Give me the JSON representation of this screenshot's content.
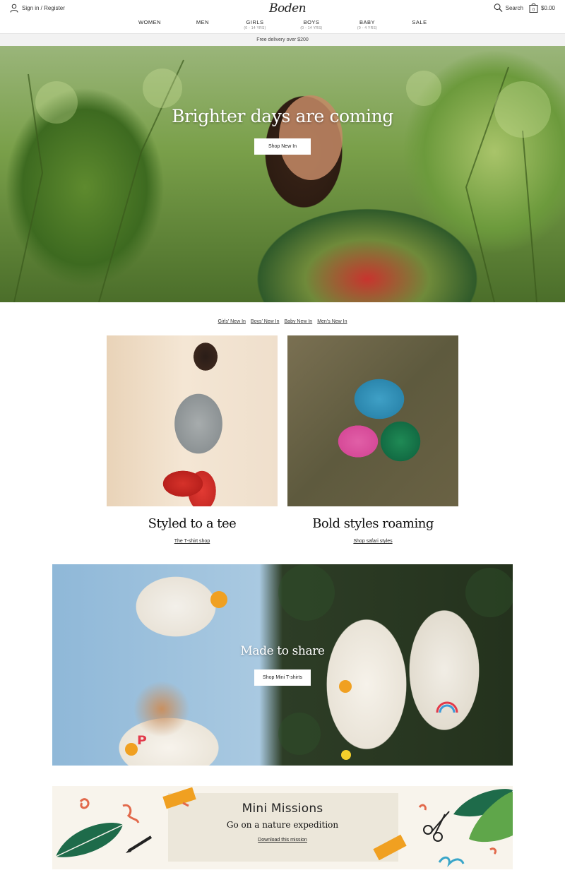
{
  "header": {
    "signin_label": "Sign in / Register",
    "logo": "Boden",
    "search_label": "Search",
    "bag_total": "$0.00",
    "bag_count": "0"
  },
  "nav": [
    {
      "label": "WOMEN",
      "sub": ""
    },
    {
      "label": "MEN",
      "sub": ""
    },
    {
      "label": "GIRLS",
      "sub": "(0 - 14 YRS)"
    },
    {
      "label": "BOYS",
      "sub": "(0 - 14 YRS)"
    },
    {
      "label": "BABY",
      "sub": "(0 - 4 YRS)"
    },
    {
      "label": "SALE",
      "sub": ""
    }
  ],
  "promo": "Free delivery over $200",
  "hero": {
    "title": "Brighter days are coming",
    "button": "Shop New In"
  },
  "category_links": [
    "Girls’ New In",
    "Boys’ New In",
    "Baby New In",
    "Men’s New In"
  ],
  "tiles": [
    {
      "title": "Styled to a tee",
      "link": "The T-shirt shop"
    },
    {
      "title": "Bold styles roaming",
      "link": "Shop safari styles"
    }
  ],
  "share": {
    "title": "Made to share",
    "button": "Shop Mini T-shirts"
  },
  "mission": {
    "title": "Mini Missions",
    "subtitle": "Go on a nature expedition",
    "link": "Download this mission"
  },
  "colors": {
    "accent_orange": "#f0a021",
    "leaf_green": "#1e6b4a"
  }
}
